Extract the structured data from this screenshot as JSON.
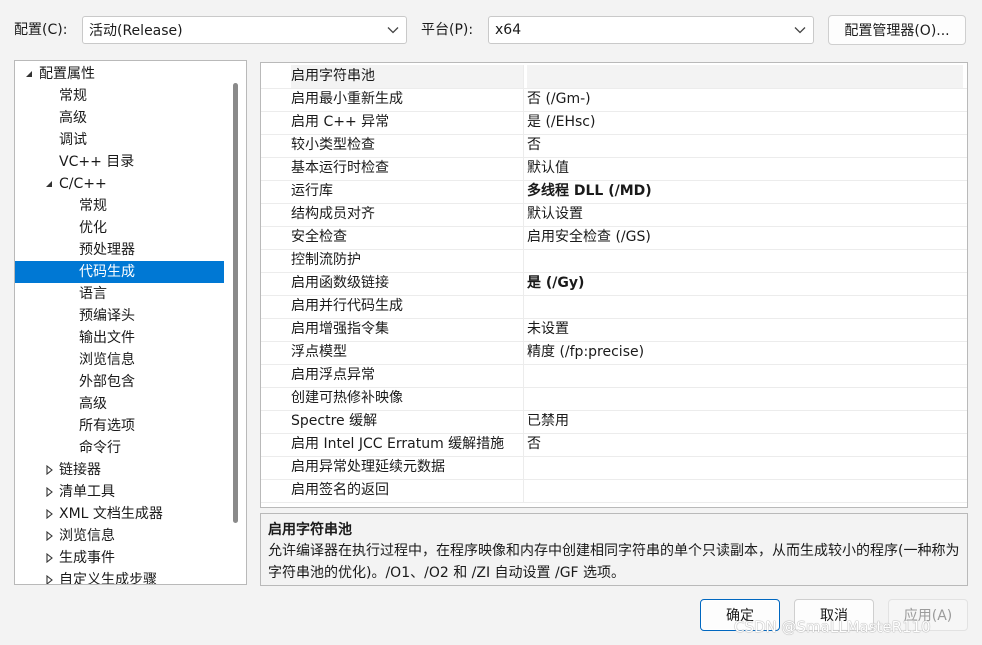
{
  "toolbar": {
    "config_label": "配置(C):",
    "config_value": "活动(Release)",
    "platform_label": "平台(P):",
    "platform_value": "x64",
    "config_manager_label": "配置管理器(O)..."
  },
  "tree": {
    "items": [
      {
        "label": "配置属性",
        "level": 0,
        "expander": "expanded"
      },
      {
        "label": "常规",
        "level": 1,
        "expander": "none"
      },
      {
        "label": "高级",
        "level": 1,
        "expander": "none"
      },
      {
        "label": "调试",
        "level": 1,
        "expander": "none"
      },
      {
        "label": "VC++ 目录",
        "level": 1,
        "expander": "none"
      },
      {
        "label": "C/C++",
        "level": 1,
        "expander": "expanded"
      },
      {
        "label": "常规",
        "level": 2,
        "expander": "none"
      },
      {
        "label": "优化",
        "level": 2,
        "expander": "none"
      },
      {
        "label": "预处理器",
        "level": 2,
        "expander": "none"
      },
      {
        "label": "代码生成",
        "level": 2,
        "expander": "none",
        "selected": true
      },
      {
        "label": "语言",
        "level": 2,
        "expander": "none"
      },
      {
        "label": "预编译头",
        "level": 2,
        "expander": "none"
      },
      {
        "label": "输出文件",
        "level": 2,
        "expander": "none"
      },
      {
        "label": "浏览信息",
        "level": 2,
        "expander": "none"
      },
      {
        "label": "外部包含",
        "level": 2,
        "expander": "none"
      },
      {
        "label": "高级",
        "level": 2,
        "expander": "none"
      },
      {
        "label": "所有选项",
        "level": 2,
        "expander": "none"
      },
      {
        "label": "命令行",
        "level": 2,
        "expander": "none"
      },
      {
        "label": "链接器",
        "level": 1,
        "expander": "collapsed"
      },
      {
        "label": "清单工具",
        "level": 1,
        "expander": "collapsed"
      },
      {
        "label": "XML 文档生成器",
        "level": 1,
        "expander": "collapsed"
      },
      {
        "label": "浏览信息",
        "level": 1,
        "expander": "collapsed"
      },
      {
        "label": "生成事件",
        "level": 1,
        "expander": "collapsed"
      },
      {
        "label": "自定义生成步骤",
        "level": 1,
        "expander": "collapsed"
      }
    ]
  },
  "grid": {
    "rows": [
      {
        "name": "启用字符串池",
        "value": "",
        "bold": false
      },
      {
        "name": "启用最小重新生成",
        "value": "否 (/Gm-)",
        "bold": false
      },
      {
        "name": "启用 C++ 异常",
        "value": "是 (/EHsc)",
        "bold": false
      },
      {
        "name": "较小类型检查",
        "value": "否",
        "bold": false
      },
      {
        "name": "基本运行时检查",
        "value": "默认值",
        "bold": false
      },
      {
        "name": "运行库",
        "value": "多线程 DLL (/MD)",
        "bold": true
      },
      {
        "name": "结构成员对齐",
        "value": "默认设置",
        "bold": false
      },
      {
        "name": "安全检查",
        "value": "启用安全检查 (/GS)",
        "bold": false
      },
      {
        "name": "控制流防护",
        "value": "",
        "bold": false
      },
      {
        "name": "启用函数级链接",
        "value": "是 (/Gy)",
        "bold": true
      },
      {
        "name": "启用并行代码生成",
        "value": "",
        "bold": false
      },
      {
        "name": "启用增强指令集",
        "value": "未设置",
        "bold": false
      },
      {
        "name": "浮点模型",
        "value": "精度 (/fp:precise)",
        "bold": false
      },
      {
        "name": "启用浮点异常",
        "value": "",
        "bold": false
      },
      {
        "name": "创建可热修补映像",
        "value": "",
        "bold": false
      },
      {
        "name": "Spectre 缓解",
        "value": "已禁用",
        "bold": false
      },
      {
        "name": "启用 Intel JCC Erratum 缓解措施",
        "value": "否",
        "bold": false
      },
      {
        "name": "启用异常处理延续元数据",
        "value": "",
        "bold": false
      },
      {
        "name": "启用签名的返回",
        "value": "",
        "bold": false
      }
    ]
  },
  "description": {
    "title": "启用字符串池",
    "text": "允许编译器在执行过程中，在程序映像和内存中创建相同字符串的单个只读副本，从而生成较小的程序(一种称为字符串池的优化)。/O1、/O2 和 /ZI 自动设置 /GF 选项。"
  },
  "buttons": {
    "ok": "确定",
    "cancel": "取消",
    "apply": "应用(A)"
  },
  "watermark": "CSDN @SmaLLMasteR110",
  "icons": {
    "dropdown": "chevron-down-icon",
    "expanded": "triangle-expanded-icon",
    "collapsed": "triangle-collapsed-icon"
  },
  "colors": {
    "selection": "#0078d4",
    "primary_border": "#0067c0"
  }
}
